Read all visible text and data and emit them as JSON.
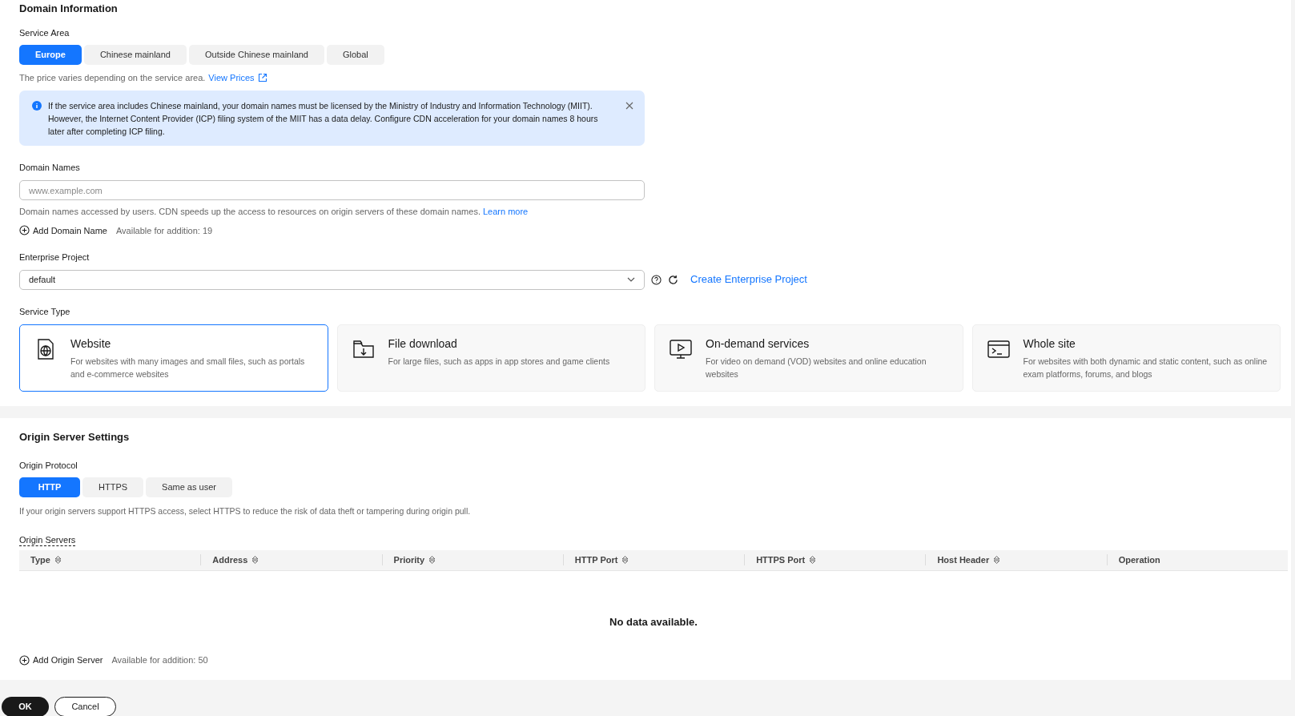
{
  "domain": {
    "title": "Domain Information",
    "service_area": {
      "label": "Service Area",
      "options": [
        {
          "label": "Europe",
          "selected": true
        },
        {
          "label": "Chinese mainland",
          "selected": false
        },
        {
          "label": "Outside Chinese mainland",
          "selected": false
        },
        {
          "label": "Global",
          "selected": false
        }
      ],
      "note": "The price varies depending on the service area.",
      "note_link": "View Prices"
    },
    "alert": {
      "text": "If the service area includes Chinese mainland, your domain names must be licensed by the Ministry of Industry and Information Technology (MIIT). However, the Internet Content Provider (ICP) filing system of the MIIT has a data delay. Configure CDN acceleration for your domain names 8 hours later after completing ICP filing."
    },
    "domain_names": {
      "label": "Domain Names",
      "placeholder": "www.example.com",
      "help": "Domain names accessed by users. CDN speeds up the access to resources on origin servers of these domain names.",
      "help_link": "Learn more",
      "add_button": "Add Domain Name",
      "available": "Available for addition: 19"
    },
    "enterprise_project": {
      "label": "Enterprise Project",
      "value": "default",
      "create_link": "Create Enterprise Project"
    },
    "service_type": {
      "label": "Service Type",
      "options": [
        {
          "kind": "website",
          "title": "Website",
          "description": "For websites with many images and small files, such as portals and e-commerce websites",
          "selected": true
        },
        {
          "kind": "download",
          "title": "File download",
          "description": "For large files, such as apps in app stores and game clients",
          "selected": false
        },
        {
          "kind": "video",
          "title": "On-demand services",
          "description": "For video on demand (VOD) websites and online education websites",
          "selected": false
        },
        {
          "kind": "terminal",
          "title": "Whole site",
          "description": "For websites with both dynamic and static content, such as online exam platforms, forums, and blogs",
          "selected": false
        }
      ]
    }
  },
  "origin": {
    "title": "Origin Server Settings",
    "protocol": {
      "label": "Origin Protocol",
      "options": [
        {
          "label": "HTTP",
          "selected": true
        },
        {
          "label": "HTTPS",
          "selected": false
        },
        {
          "label": "Same as user",
          "selected": false
        }
      ],
      "note": "If your origin servers support HTTPS access, select HTTPS to reduce the risk of data theft or tampering during origin pull."
    },
    "servers": {
      "label": "Origin Servers",
      "columns": [
        {
          "label": "Type",
          "sortable": true
        },
        {
          "label": "Address",
          "sortable": true
        },
        {
          "label": "Priority",
          "sortable": true
        },
        {
          "label": "HTTP Port",
          "sortable": true
        },
        {
          "label": "HTTPS Port",
          "sortable": true
        },
        {
          "label": "Host Header",
          "sortable": true
        },
        {
          "label": "Operation",
          "sortable": false
        }
      ],
      "empty": "No data available.",
      "add_button": "Add Origin Server",
      "available": "Available for addition: 50"
    }
  },
  "buttons": [
    {
      "label": "OK",
      "kind": "primary"
    },
    {
      "label": "Cancel",
      "kind": "secondary"
    }
  ]
}
